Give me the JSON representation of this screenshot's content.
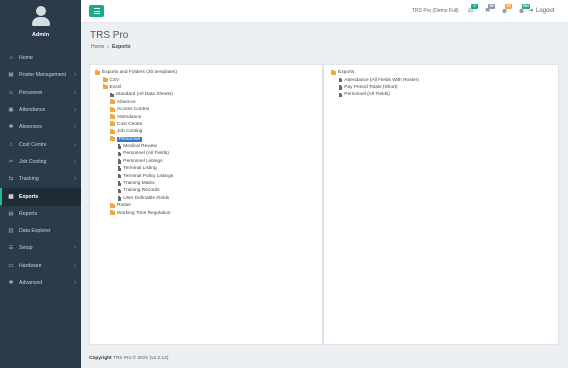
{
  "app": {
    "title": "TRS Pro",
    "company": "TRS Pro (Demo Full)"
  },
  "profile": {
    "name": "Admin"
  },
  "sidebar": {
    "items": [
      {
        "label": "Home",
        "icon": "home-icon",
        "glyph": "⌂",
        "chevron": false,
        "active": false
      },
      {
        "label": "Roster Management",
        "icon": "grid-icon",
        "glyph": "▦",
        "chevron": true,
        "active": false
      },
      {
        "label": "Personnel",
        "icon": "users-icon",
        "glyph": "☺",
        "chevron": true,
        "active": false
      },
      {
        "label": "Attendance",
        "icon": "briefcase-icon",
        "glyph": "▣",
        "chevron": true,
        "active": false
      },
      {
        "label": "Absences",
        "icon": "asterisk-icon",
        "glyph": "✱",
        "chevron": true,
        "active": false
      },
      {
        "label": "Cost Centre",
        "icon": "bank-icon",
        "glyph": "⌂",
        "chevron": true,
        "active": false
      },
      {
        "label": "Job Costing",
        "icon": "tools-icon",
        "glyph": "✂",
        "chevron": true,
        "active": false
      },
      {
        "label": "Tracking",
        "icon": "tag-icon",
        "glyph": "⇆",
        "chevron": true,
        "active": false
      },
      {
        "label": "Exports",
        "icon": "file-icon",
        "glyph": "▤",
        "chevron": false,
        "active": true
      },
      {
        "label": "Reports",
        "icon": "report-icon",
        "glyph": "▤",
        "chevron": false,
        "active": false
      },
      {
        "label": "Data Explorer",
        "icon": "database-icon",
        "glyph": "▥",
        "chevron": false,
        "active": false
      },
      {
        "label": "Setup",
        "icon": "setup-icon",
        "glyph": "☰",
        "chevron": true,
        "active": false
      },
      {
        "label": "Hardware",
        "icon": "monitor-icon",
        "glyph": "▭",
        "chevron": true,
        "active": false
      },
      {
        "label": "Advanced",
        "icon": "gear-icon",
        "glyph": "✱",
        "chevron": true,
        "active": false
      }
    ]
  },
  "topbar": {
    "badges": [
      {
        "icon": "announcement-icon",
        "glyph": "✉",
        "count": "0",
        "color": "#1aab8b"
      },
      {
        "icon": "flag-icon",
        "glyph": "⚑",
        "count": "38",
        "color": "#8a99a8"
      },
      {
        "icon": "users-group-icon",
        "glyph": "☻",
        "count": "35",
        "color": "#f0a740"
      },
      {
        "icon": "users-alert-icon",
        "glyph": "☻",
        "count": "594",
        "color": "#1aab8b"
      }
    ],
    "logout_label": "Logout"
  },
  "page": {
    "title": "TRS Pro",
    "breadcrumb": {
      "home": "Home",
      "current": "Exports"
    }
  },
  "left_tree": [
    {
      "label": "Exports and Folders (30 templates)",
      "type": "folder",
      "depth": 0
    },
    {
      "label": "CSV",
      "type": "folder",
      "depth": 1
    },
    {
      "label": "Excel",
      "type": "folder",
      "depth": 1
    },
    {
      "label": "Standard (All Data Sheets)",
      "type": "doc",
      "depth": 2
    },
    {
      "label": "Absence",
      "type": "folder",
      "depth": 2
    },
    {
      "label": "Access Control",
      "type": "folder",
      "depth": 2
    },
    {
      "label": "Attendance",
      "type": "folder",
      "depth": 2
    },
    {
      "label": "Cost Centre",
      "type": "folder",
      "depth": 2
    },
    {
      "label": "Job Costing",
      "type": "folder",
      "depth": 2
    },
    {
      "label": "Personnel",
      "type": "folder",
      "depth": 2,
      "selected": true
    },
    {
      "label": "Medical Review",
      "type": "doc",
      "depth": 3
    },
    {
      "label": "Personnel (All Fields)",
      "type": "doc",
      "depth": 3
    },
    {
      "label": "Personnel Listings",
      "type": "doc",
      "depth": 3
    },
    {
      "label": "Terminal Listing",
      "type": "doc",
      "depth": 3
    },
    {
      "label": "Terminal Policy Listings",
      "type": "doc",
      "depth": 3
    },
    {
      "label": "Training Matrix",
      "type": "doc",
      "depth": 3
    },
    {
      "label": "Training Records",
      "type": "doc",
      "depth": 3
    },
    {
      "label": "User Definable Fields",
      "type": "doc",
      "depth": 3
    },
    {
      "label": "Roster",
      "type": "folder",
      "depth": 2
    },
    {
      "label": "Working Time Regulation",
      "type": "folder",
      "depth": 2
    }
  ],
  "right_tree": [
    {
      "label": "Exports",
      "type": "folder",
      "depth": 0
    },
    {
      "label": "Attendance (All Fields With Roster)",
      "type": "doc",
      "depth": 1
    },
    {
      "label": "Pay Period Totals (Short)",
      "type": "doc",
      "depth": 1
    },
    {
      "label": "Personnel (All Fields)",
      "type": "doc",
      "depth": 1
    }
  ],
  "footer": {
    "copyright": "Copyright",
    "text": "TRS Pro © 2021 (v2.2.13)"
  }
}
